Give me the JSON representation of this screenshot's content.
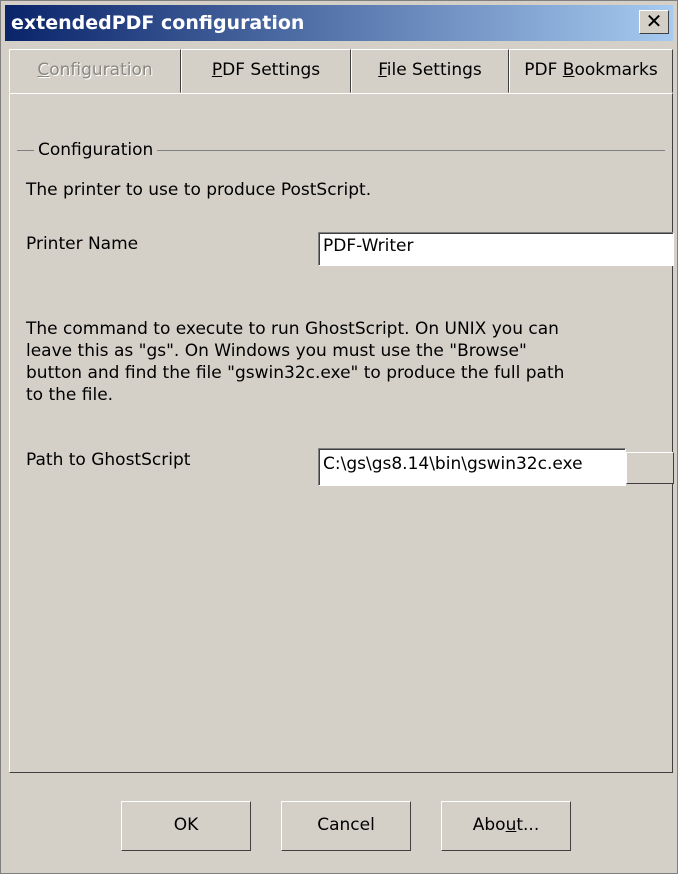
{
  "window": {
    "title": "extendedPDF configuration",
    "close_symbol": "✕"
  },
  "tabs": [
    {
      "pre": "",
      "accel": "C",
      "post": "onfiguration",
      "selected": true
    },
    {
      "pre": "",
      "accel": "P",
      "post": "DF Settings",
      "selected": false
    },
    {
      "pre": "",
      "accel": "F",
      "post": "ile Settings",
      "selected": false
    },
    {
      "pre": "PDF ",
      "accel": "B",
      "post": "ookmarks",
      "selected": false
    }
  ],
  "group": {
    "legend": "Configuration"
  },
  "printer": {
    "description": "The printer to use to produce PostScript.",
    "label": "Printer Name",
    "value": "PDF-Writer"
  },
  "ghostscript": {
    "description_lines": [
      "The command to execute to run GhostScript.   On UNIX you can",
      "leave this as \"gs\".   On Windows you must use the \"Browse\"",
      "button and find the file \"gswin32c.exe\" to produce the full path",
      "to the file."
    ],
    "label": "Path to GhostScript",
    "value": "C:\\gs\\gs8.14\\bin\\gswin32c.exe"
  },
  "buttons": {
    "ok": "OK",
    "cancel": "Cancel",
    "about_pre": "Abo",
    "about_accel": "u",
    "about_post": "t..."
  }
}
